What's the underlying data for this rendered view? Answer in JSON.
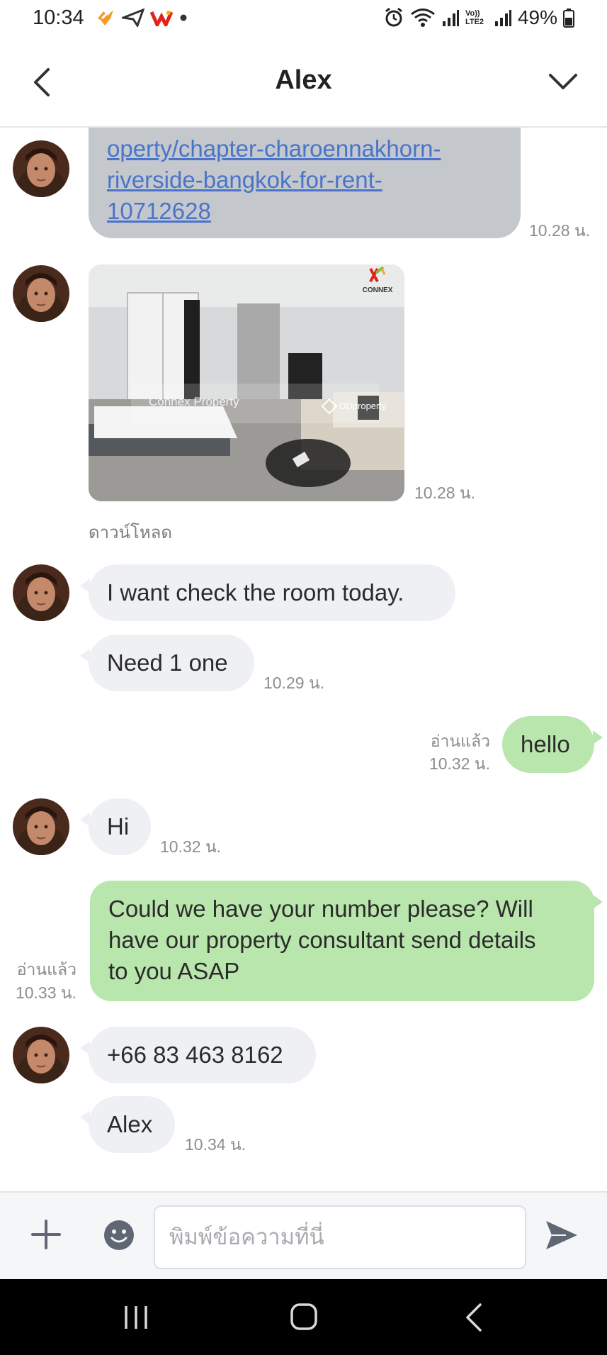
{
  "status_bar": {
    "time": "10:34",
    "volte_label": "Vo)) LTE2",
    "battery": "49%"
  },
  "header": {
    "title": "Alex"
  },
  "messages": {
    "link": {
      "text_line1": "operty/chapter-charoennakhorn-",
      "text_line2": "riverside-bangkok-for-rent-",
      "text_line3": "10712628",
      "time": "10.28 น."
    },
    "image": {
      "time": "10.28 น.",
      "download_label": "ดาวน์โหลด",
      "watermark_brand": "CONNEX",
      "watermark_text": "Connex Property",
      "watermark_site": "DDproperty"
    },
    "in1": {
      "text": "I want check the room today."
    },
    "in2": {
      "text": "Need 1 one",
      "time": "10.29 น."
    },
    "out1": {
      "text": "hello",
      "read": "อ่านแล้ว",
      "time": "10.32 น."
    },
    "in3": {
      "text": "Hi",
      "time": "10.32 น."
    },
    "out2": {
      "line1": "Could we have your number please? Will",
      "line2": "have our property consultant send details",
      "line3": "to you ASAP",
      "read": "อ่านแล้ว",
      "time": "10.33 น."
    },
    "in4": {
      "text": "+66 83 463 8162"
    },
    "in5": {
      "text": "Alex",
      "time": "10.34 น."
    }
  },
  "input": {
    "placeholder": "พิมพ์ข้อความที่นี่"
  },
  "icons": {
    "back": "chevron-left-icon",
    "menu": "chevron-down-icon",
    "plus": "plus-icon",
    "emoji": "smiley-icon",
    "send": "send-icon"
  },
  "colors": {
    "incoming_bubble": "#eef0f3",
    "outgoing_bubble": "#b8e6ac",
    "link_bubble": "#c4c8cd",
    "link_text": "#4a74c9"
  }
}
